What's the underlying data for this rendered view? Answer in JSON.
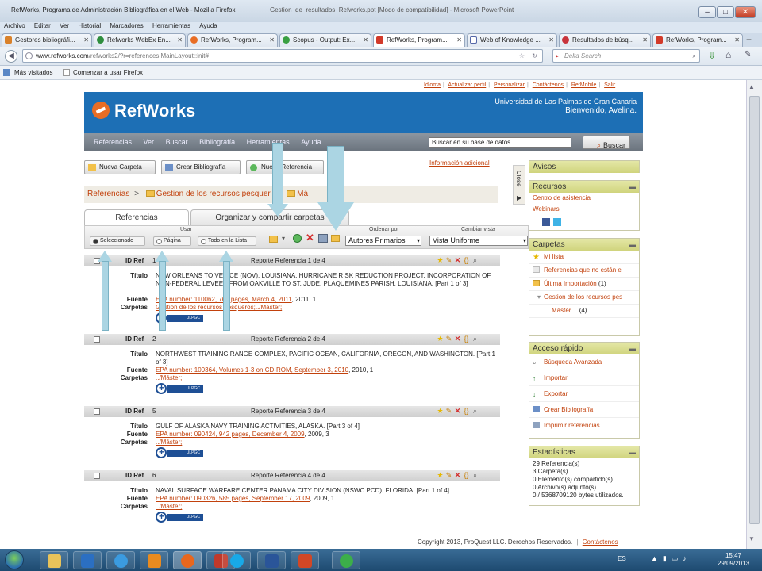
{
  "browser": {
    "window_title": "RefWorks, Programa de Administración Bibliográfica en el Web - Mozilla Firefox",
    "background_title": "Gestion_de_resultados_Refworks.ppt [Modo de compatibilidad] - Microsoft PowerPoint",
    "menu": [
      "Archivo",
      "Editar",
      "Ver",
      "Historial",
      "Marcadores",
      "Herramientas",
      "Ayuda"
    ],
    "tabs": [
      {
        "label": "Gestores bibliográfi...",
        "color": "#d9812a"
      },
      {
        "label": "Refworks WebEx En...",
        "color": "#2f8e3e"
      },
      {
        "label": "RefWorks, Program...",
        "color": "#e86d25"
      },
      {
        "label": "Scopus - Output: Ex...",
        "color": "#3aa042"
      },
      {
        "label": "RefWorks, Program...",
        "color": "#d23a2a"
      },
      {
        "label": "Web of Knowledge ...",
        "color": "#5567a8"
      },
      {
        "label": "Resultados de búsq...",
        "color": "#c8333b"
      },
      {
        "label": "RefWorks, Program...",
        "color": "#d23a2a"
      }
    ],
    "url_host": "www.refworks.com",
    "url_path": "/refworks2/?r=references|MainLayout::init#",
    "search_placeholder": "Delta Search",
    "bookmarks": [
      "Más visitados",
      "Comenzar a usar Firefox"
    ]
  },
  "top_links": [
    "Idioma",
    "Actualizar perfil",
    "Personalizar",
    "Contáctenos",
    "RefMobile",
    "Salir"
  ],
  "header": {
    "logo": "RefWorks",
    "institution": "Universidad de Las Palmas de Gran Canaria",
    "welcome": "Bienvenido, Avelina."
  },
  "nav": [
    "Referencias",
    "Ver",
    "Buscar",
    "Bibliografía",
    "Herramientas",
    "Ayuda"
  ],
  "search": {
    "value": "Buscar en su base de datos",
    "button": "Buscar"
  },
  "toolbar": {
    "new_folder": "Nueva Carpeta",
    "create_bib": "Crear Bibliografía",
    "new_ref": "Nueva Referencia",
    "more_info": "Información adicional"
  },
  "breadcrumb": {
    "root": "Referencias",
    "sep": ">",
    "folder": "Gestion de los recursos pesquer",
    "sub": "Má"
  },
  "view_tabs": [
    "Referencias",
    "Organizar y compartir carpetas"
  ],
  "use": {
    "label": "Usar",
    "options": [
      "Seleccionado",
      "Página",
      "Todo en la Lista"
    ],
    "sort_label": "Ordenar por",
    "sort_value": "Autores Primarios",
    "view_label": "Cambiar vista",
    "view_value": "Vista Uniforme"
  },
  "field_labels": {
    "id": "ID Ref",
    "title": "Título",
    "source": "Fuente",
    "folders": "Carpetas"
  },
  "records": [
    {
      "id": "1",
      "header": "Reporte Referencia 1 de 4",
      "title": "NEW ORLEANS TO VENICE (NOV), LOUISIANA, HURRICANE RISK REDUCTION PROJECT, INCORPORATION OF NON-FEDERAL LEVEES FROM OAKVILLE TO ST. JUDE, PLAQUEMINES PARISH, LOUISIANA. [Part 1 of 3]",
      "source_link": "EPA number: 110062, 769 pages, March 4, 2011",
      "source_rest": ", 2011, 1",
      "folders": "Gestion de los recursos pesqueros;../Máster;"
    },
    {
      "id": "2",
      "header": "Reporte Referencia 2 de 4",
      "title": "NORTHWEST TRAINING RANGE COMPLEX, PACIFIC OCEAN, CALIFORNIA, OREGON, AND WASHINGTON. [Part 1 of 3]",
      "source_link": "EPA number: 100364, Volumes 1-3 on CD-ROM, September 3, 2010",
      "source_rest": ", 2010, 1",
      "folders": "../Máster;"
    },
    {
      "id": "5",
      "header": "Reporte Referencia 3 de 4",
      "title": "GULF OF ALASKA NAVY TRAINING ACTIVITIES, ALASKA. [Part 3 of 4]",
      "source_link": "EPA number: 090424, 942 pages, December 4, 2009",
      "source_rest": ", 2009, 3",
      "folders": "../Máster;"
    },
    {
      "id": "6",
      "header": "Reporte Referencia 4 de 4",
      "title": "NAVAL SURFACE WARFARE CENTER PANAMA CITY DIVISION (NSWC PCD), FLORIDA. [Part 1 of 4]",
      "source_link": "EPA number: 090326, 585 pages, September 17, 2009",
      "source_rest": ", 2009, 1",
      "folders": "../Máster;"
    }
  ],
  "ulpgc_label": "ULPGC",
  "side": {
    "close": "Close",
    "avisos": "Avisos",
    "recursos": {
      "title": "Recursos",
      "links": [
        "Centro de asistencia",
        "Webinars"
      ]
    },
    "carpetas": {
      "title": "Carpetas",
      "items": [
        {
          "label": "Mi lista",
          "count": ""
        },
        {
          "label": "Referencias que no están e",
          "count": ""
        },
        {
          "label": "Última Importación",
          "count": "(1)"
        },
        {
          "label": "Gestion de los recursos pes",
          "count": ""
        },
        {
          "label": "Máster",
          "count": "(4)"
        }
      ]
    },
    "acceso": {
      "title": "Acceso rápido",
      "items": [
        "Búsqueda Avanzada",
        "Importar",
        "Exportar",
        "Crear Bibliografía",
        "Imprimir referencias"
      ]
    },
    "stats": {
      "title": "Estadísticas",
      "lines": [
        "29 Referencia(s)",
        "3 Carpeta(s)",
        "0 Elemento(s) compartido(s)",
        "0 Archivo(s) adjunto(s)",
        "0 / 5368709120 bytes utilizados."
      ]
    }
  },
  "footer": {
    "copy": "Copyright 2013, ProQuest LLC. Derechos Reservados.",
    "sep": "|",
    "contact": "Contáctenos"
  },
  "taskbar": {
    "lang": "ES",
    "time": "15:47",
    "date": "29/09/2013"
  },
  "colors": {
    "header_blue": "#1d6fb5",
    "link_orange": "#c2410c",
    "panel_head": "#d0d47d"
  }
}
